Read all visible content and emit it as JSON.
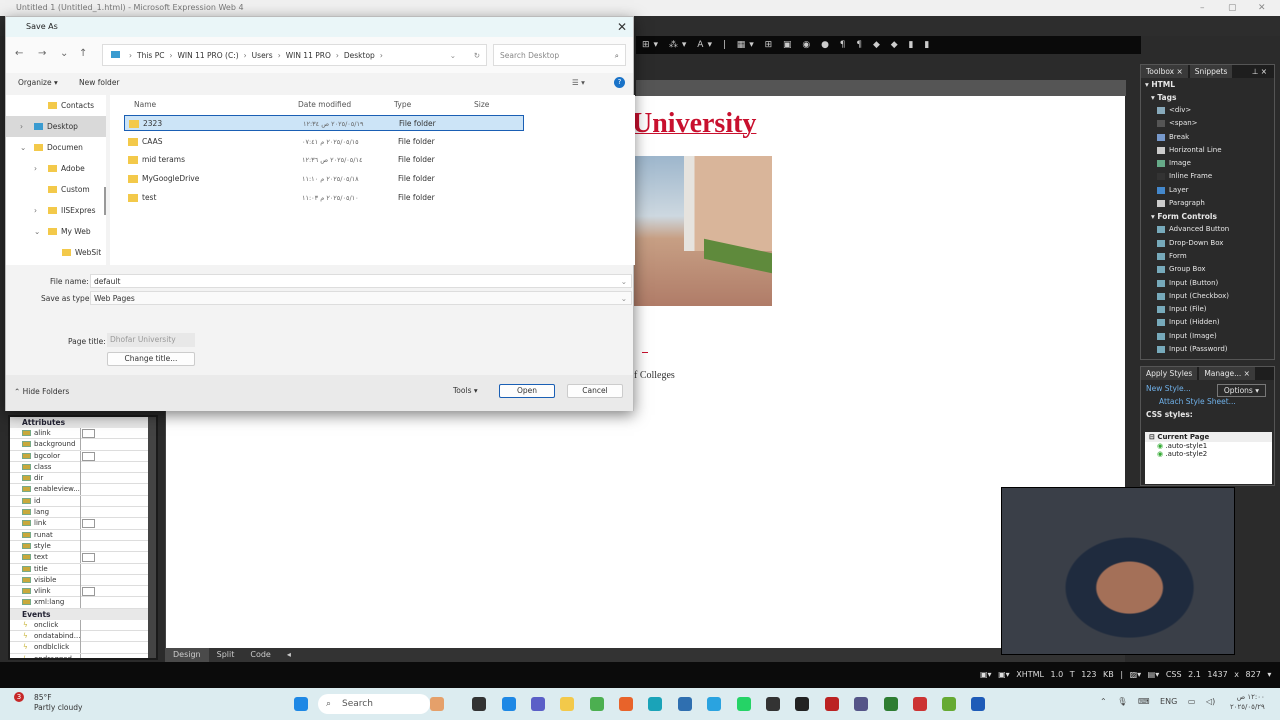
{
  "app": {
    "title": "Untitled 1 (Untitled_1.html) - Microsoft Expression Web 4",
    "minimize": "–",
    "maximize": "▢",
    "close": "✕"
  },
  "toolbar_icons": "⊞▾ ⁂▾ A▾ | ▦▾ ⊞ ▣ ◉ ● ¶ ¶ ◆ ◆ ▮ ▮",
  "page": {
    "heading": "University",
    "footer_text": "f Colleges"
  },
  "view_tabs": [
    "Design",
    "Split",
    "Code"
  ],
  "status": {
    "doctype": "XHTML 1.0 T",
    "size": "123 KB",
    "css": "CSS 2.1",
    "dimensions": "1437 x 827 ▾"
  },
  "properties": {
    "attributes_header": "Attributes",
    "attributes": [
      {
        "name": "alink",
        "swatch": true
      },
      {
        "name": "background"
      },
      {
        "name": "bgcolor",
        "swatch": true
      },
      {
        "name": "class"
      },
      {
        "name": "dir"
      },
      {
        "name": "enableview..."
      },
      {
        "name": "id"
      },
      {
        "name": "lang"
      },
      {
        "name": "link",
        "swatch": true
      },
      {
        "name": "runat"
      },
      {
        "name": "style"
      },
      {
        "name": "text",
        "swatch": true
      },
      {
        "name": "title"
      },
      {
        "name": "visible"
      },
      {
        "name": "vlink",
        "swatch": true
      },
      {
        "name": "xml:lang"
      }
    ],
    "events_header": "Events",
    "events": [
      "onclick",
      "ondatabind...",
      "ondblclick",
      "ondragged..."
    ]
  },
  "toolbox": {
    "tabs": [
      "Toolbox ×",
      "Snippets"
    ],
    "pin": "⊥ ×",
    "html": "HTML",
    "tags_header": "Tags",
    "tags": [
      "<div>",
      "<span>",
      "Break",
      "Horizontal Line",
      "Image",
      "Inline Frame",
      "Layer",
      "Paragraph"
    ],
    "form_header": "Form Controls",
    "forms": [
      "Advanced Button",
      "Drop-Down Box",
      "Form",
      "Group Box",
      "Input (Button)",
      "Input (Checkbox)",
      "Input (File)",
      "Input (Hidden)",
      "Input (Image)",
      "Input (Password)"
    ]
  },
  "styles_panel": {
    "tabs": [
      "Apply Styles",
      "Manage... ×"
    ],
    "new_style": "New Style...",
    "options": "Options ▾",
    "attach": "Attach Style Sheet...",
    "css_styles": "CSS styles:",
    "current_page": "Current Page",
    "styles": [
      ".auto-style1",
      ".auto-style2"
    ]
  },
  "dialog": {
    "title": "Save As",
    "breadcrumb": [
      "This PC",
      "WIN 11 PRO (C:)",
      "Users",
      "WIN 11 PRO",
      "Desktop"
    ],
    "search_placeholder": "Search Desktop",
    "organize": "Organize ▾",
    "new_folder": "New folder",
    "nav": [
      {
        "label": "Contacts",
        "indent": 2
      },
      {
        "label": "Desktop",
        "indent": 1,
        "selected": true,
        "chev": "›"
      },
      {
        "label": "Documen",
        "indent": 1,
        "chev": "⌄"
      },
      {
        "label": "Adobe",
        "indent": 2,
        "chev": "›"
      },
      {
        "label": "Custom",
        "indent": 2
      },
      {
        "label": "IISExpres",
        "indent": 2,
        "chev": "›"
      },
      {
        "label": "My Web",
        "indent": 2,
        "chev": "⌄"
      },
      {
        "label": "WebSit",
        "indent": 3
      }
    ],
    "columns": [
      "Name",
      "Date modified",
      "Type",
      "Size"
    ],
    "files": [
      {
        "name": "2323",
        "date": "٢٠٢٥/٠٥/١٩ ص ١٢:٣٤",
        "type": "File folder",
        "selected": true
      },
      {
        "name": "CAAS",
        "date": "٢٠٢٥/٠٥/١٥ م ٠٧:٤١",
        "type": "File folder"
      },
      {
        "name": "mid terams",
        "date": "٢٠٢٥/٠٥/١٤ ص ١٢:٣٦",
        "type": "File folder"
      },
      {
        "name": "MyGoogleDrive",
        "date": "٢٠٢٥/٠٥/١٨ م ١١:١٠",
        "type": "File folder"
      },
      {
        "name": "test",
        "date": "٢٠٢٥/٠٥/١٠ م ١١:٠٣",
        "type": "File folder"
      }
    ],
    "file_name_label": "File name:",
    "file_name": "default",
    "save_type_label": "Save as type:",
    "save_type": "Web Pages",
    "page_title_label": "Page title:",
    "page_title": "Dhofar University",
    "change_title": "Change title...",
    "hide_folders": "Hide Folders",
    "tools": "Tools ▾",
    "open": "Open",
    "cancel": "Cancel"
  },
  "taskbar": {
    "temp": "85°F",
    "weather": "Partly cloudy",
    "weather_badge": "3",
    "search": "Search",
    "lang": "ENG",
    "time": "١٢:٠٠ ص",
    "date": "٢٠٢٥/٠٥/٢٩"
  }
}
